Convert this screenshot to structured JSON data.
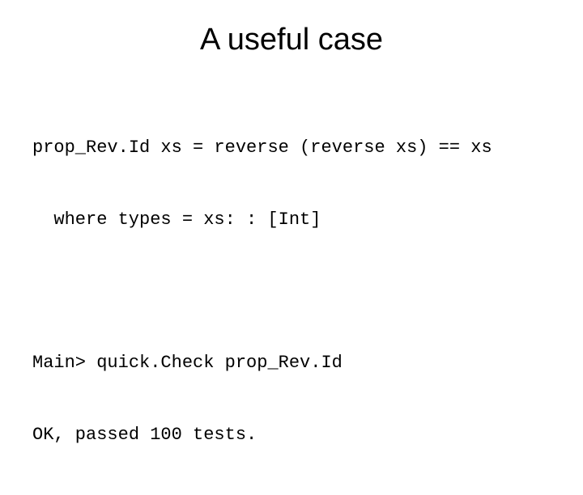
{
  "title": "A useful case",
  "code1": {
    "line1": "prop_Rev.Id xs = reverse (reverse xs) == xs",
    "line2": "where types = xs: : [Int]"
  },
  "code2": {
    "line1": "Main> quick.Check prop_Rev.Id",
    "line2": "OK, passed 100 tests."
  }
}
